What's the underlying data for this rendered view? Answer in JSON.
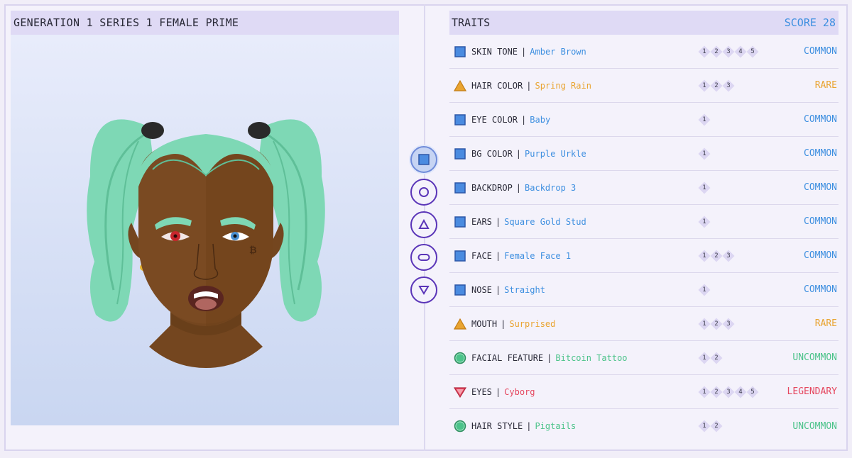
{
  "left_panel": {
    "title": "GENERATION 1 SERIES 1 FEMALE PRIME"
  },
  "selectors": [
    {
      "icon": "square-icon",
      "active": true
    },
    {
      "icon": "circle-icon",
      "active": false
    },
    {
      "icon": "triangle-icon",
      "active": false
    },
    {
      "icon": "pill-icon",
      "active": false
    },
    {
      "icon": "inverted-triangle-icon",
      "active": false
    }
  ],
  "traits_panel": {
    "title": "TRAITS",
    "score": "SCORE 28"
  },
  "colors": {
    "common": "#3d8fe0",
    "rare": "#e9a431",
    "uncommon": "#4cc38a",
    "legendary": "#e5475f"
  },
  "traits": [
    {
      "name": "SKIN TONE",
      "value": "Amber Brown",
      "levels": [
        "1",
        "2",
        "3",
        "4",
        "5"
      ],
      "rarity": "COMMON",
      "rarity_class": "common",
      "icon": "square-icon"
    },
    {
      "name": "HAIR COLOR",
      "value": "Spring Rain",
      "levels": [
        "1",
        "2",
        "3"
      ],
      "rarity": "RARE",
      "rarity_class": "rare",
      "icon": "triangle-icon"
    },
    {
      "name": "EYE COLOR",
      "value": "Baby",
      "levels": [
        "1"
      ],
      "rarity": "COMMON",
      "rarity_class": "common",
      "icon": "square-icon"
    },
    {
      "name": "BG COLOR",
      "value": "Purple Urkle",
      "levels": [
        "1"
      ],
      "rarity": "COMMON",
      "rarity_class": "common",
      "icon": "square-icon"
    },
    {
      "name": "BACKDROP",
      "value": "Backdrop 3",
      "levels": [
        "1"
      ],
      "rarity": "COMMON",
      "rarity_class": "common",
      "icon": "square-icon"
    },
    {
      "name": "EARS",
      "value": "Square Gold Stud",
      "levels": [
        "1"
      ],
      "rarity": "COMMON",
      "rarity_class": "common",
      "icon": "square-icon"
    },
    {
      "name": "FACE",
      "value": "Female Face 1",
      "levels": [
        "1",
        "2",
        "3"
      ],
      "rarity": "COMMON",
      "rarity_class": "common",
      "icon": "square-icon"
    },
    {
      "name": "NOSE",
      "value": "Straight",
      "levels": [
        "1"
      ],
      "rarity": "COMMON",
      "rarity_class": "common",
      "icon": "square-icon"
    },
    {
      "name": "MOUTH",
      "value": "Surprised",
      "levels": [
        "1",
        "2",
        "3"
      ],
      "rarity": "RARE",
      "rarity_class": "rare",
      "icon": "triangle-icon"
    },
    {
      "name": "FACIAL FEATURE",
      "value": "Bitcoin Tattoo",
      "levels": [
        "1",
        "2"
      ],
      "rarity": "UNCOMMON",
      "rarity_class": "uncommon",
      "icon": "circle-icon"
    },
    {
      "name": "EYES",
      "value": "Cyborg",
      "levels": [
        "1",
        "2",
        "3",
        "4",
        "5"
      ],
      "rarity": "LEGENDARY",
      "rarity_class": "legendary",
      "icon": "gem-icon"
    },
    {
      "name": "HAIR STYLE",
      "value": "Pigtails",
      "levels": [
        "1",
        "2"
      ],
      "rarity": "UNCOMMON",
      "rarity_class": "uncommon",
      "icon": "circle-icon"
    }
  ]
}
